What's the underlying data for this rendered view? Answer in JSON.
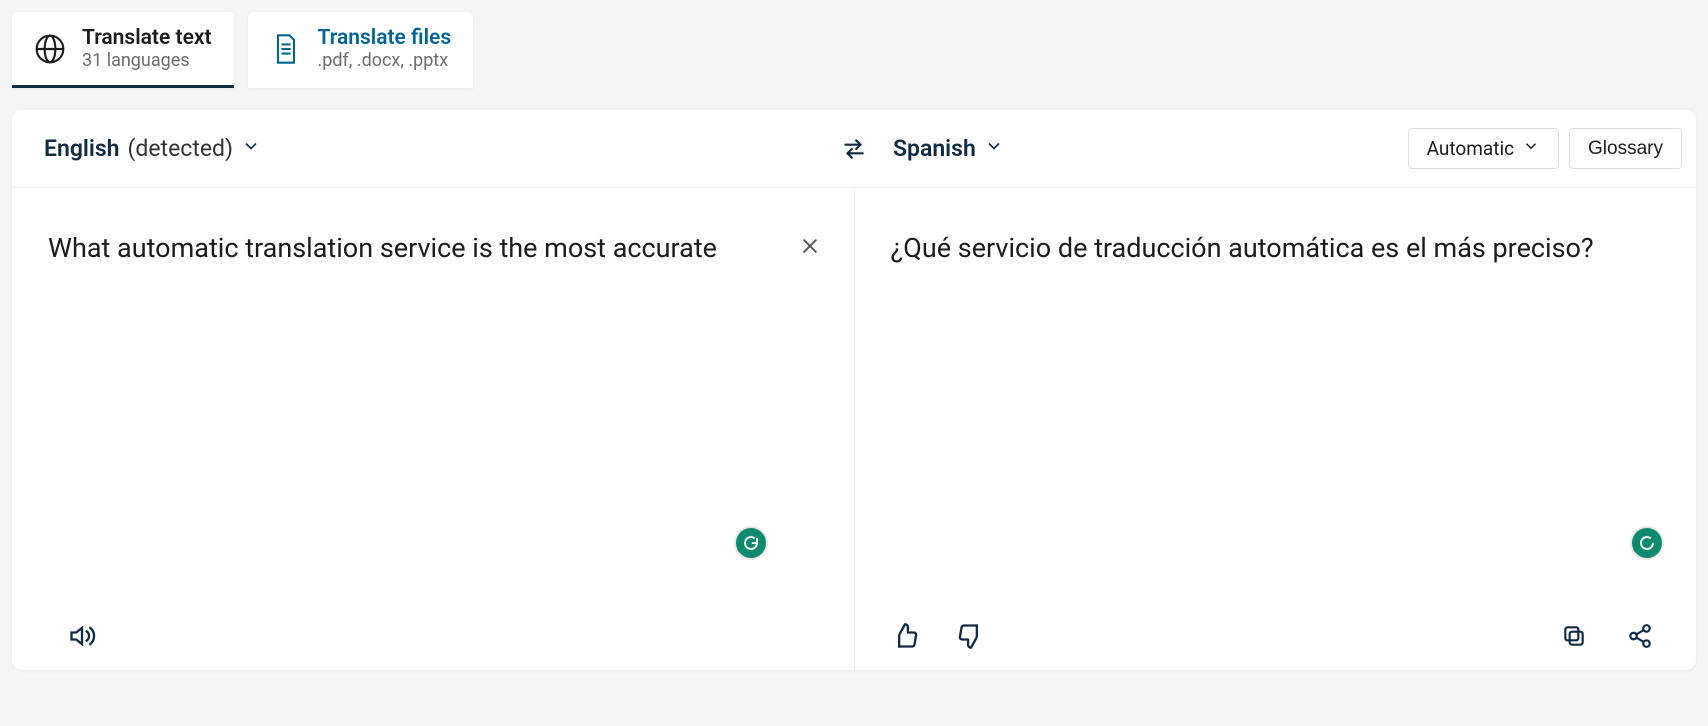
{
  "tabs": {
    "text": {
      "title": "Translate text",
      "sub": "31 languages"
    },
    "files": {
      "title": "Translate files",
      "sub": ".pdf, .docx, .pptx"
    }
  },
  "source": {
    "lang_label": "English",
    "lang_suffix": "(detected)",
    "text": "What automatic translation service is the most accurate"
  },
  "target": {
    "lang_label": "Spanish",
    "text": "¿Qué servicio de traducción automática es el más preciso?"
  },
  "controls": {
    "tone_label": "Automatic",
    "glossary_label": "Glossary"
  }
}
